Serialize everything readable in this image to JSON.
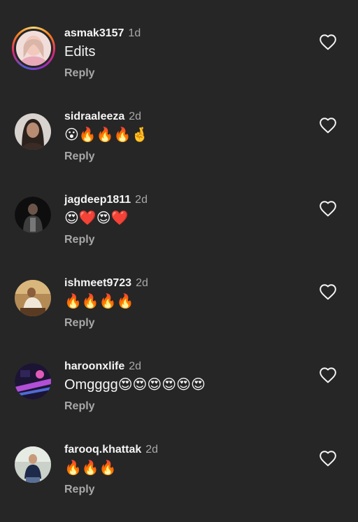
{
  "comments": [
    {
      "username": "asmak3157",
      "time": "1d",
      "text": "Edits",
      "reply_label": "Reply",
      "avatar_colors": [
        "#f3d7d2",
        "#e7b8ae"
      ],
      "story_ring": true
    },
    {
      "username": "sidraaleeza",
      "time": "2d",
      "text": "😮🔥🔥🔥🤞",
      "reply_label": "Reply",
      "avatar_colors": [
        "#d9d4d0",
        "#2b211d"
      ],
      "story_ring": false
    },
    {
      "username": "jagdeep1811",
      "time": "2d",
      "text": "😍❤️😍❤️",
      "reply_label": "Reply",
      "avatar_colors": [
        "#111111",
        "#4a4a4a"
      ],
      "story_ring": false
    },
    {
      "username": "ishmeet9723",
      "time": "2d",
      "text": "🔥🔥🔥🔥",
      "reply_label": "Reply",
      "avatar_colors": [
        "#c9a46c",
        "#7b5b3a"
      ],
      "story_ring": false
    },
    {
      "username": "haroonxlife",
      "time": "2d",
      "text": "Omgggg😍😍😍😍😍😍",
      "reply_label": "Reply",
      "avatar_colors": [
        "#2a1b4d",
        "#b24fd6"
      ],
      "story_ring": false
    },
    {
      "username": "farooq.khattak",
      "time": "2d",
      "text": "🔥🔥🔥",
      "reply_label": "Reply",
      "avatar_colors": [
        "#bfc8c0",
        "#1d2a4a"
      ],
      "story_ring": false
    }
  ],
  "icons": {
    "like": "heart-outline-icon"
  },
  "colors": {
    "background": "#262626",
    "secondary_text": "#a8a8a8",
    "primary_text": "#f5f5f5"
  }
}
